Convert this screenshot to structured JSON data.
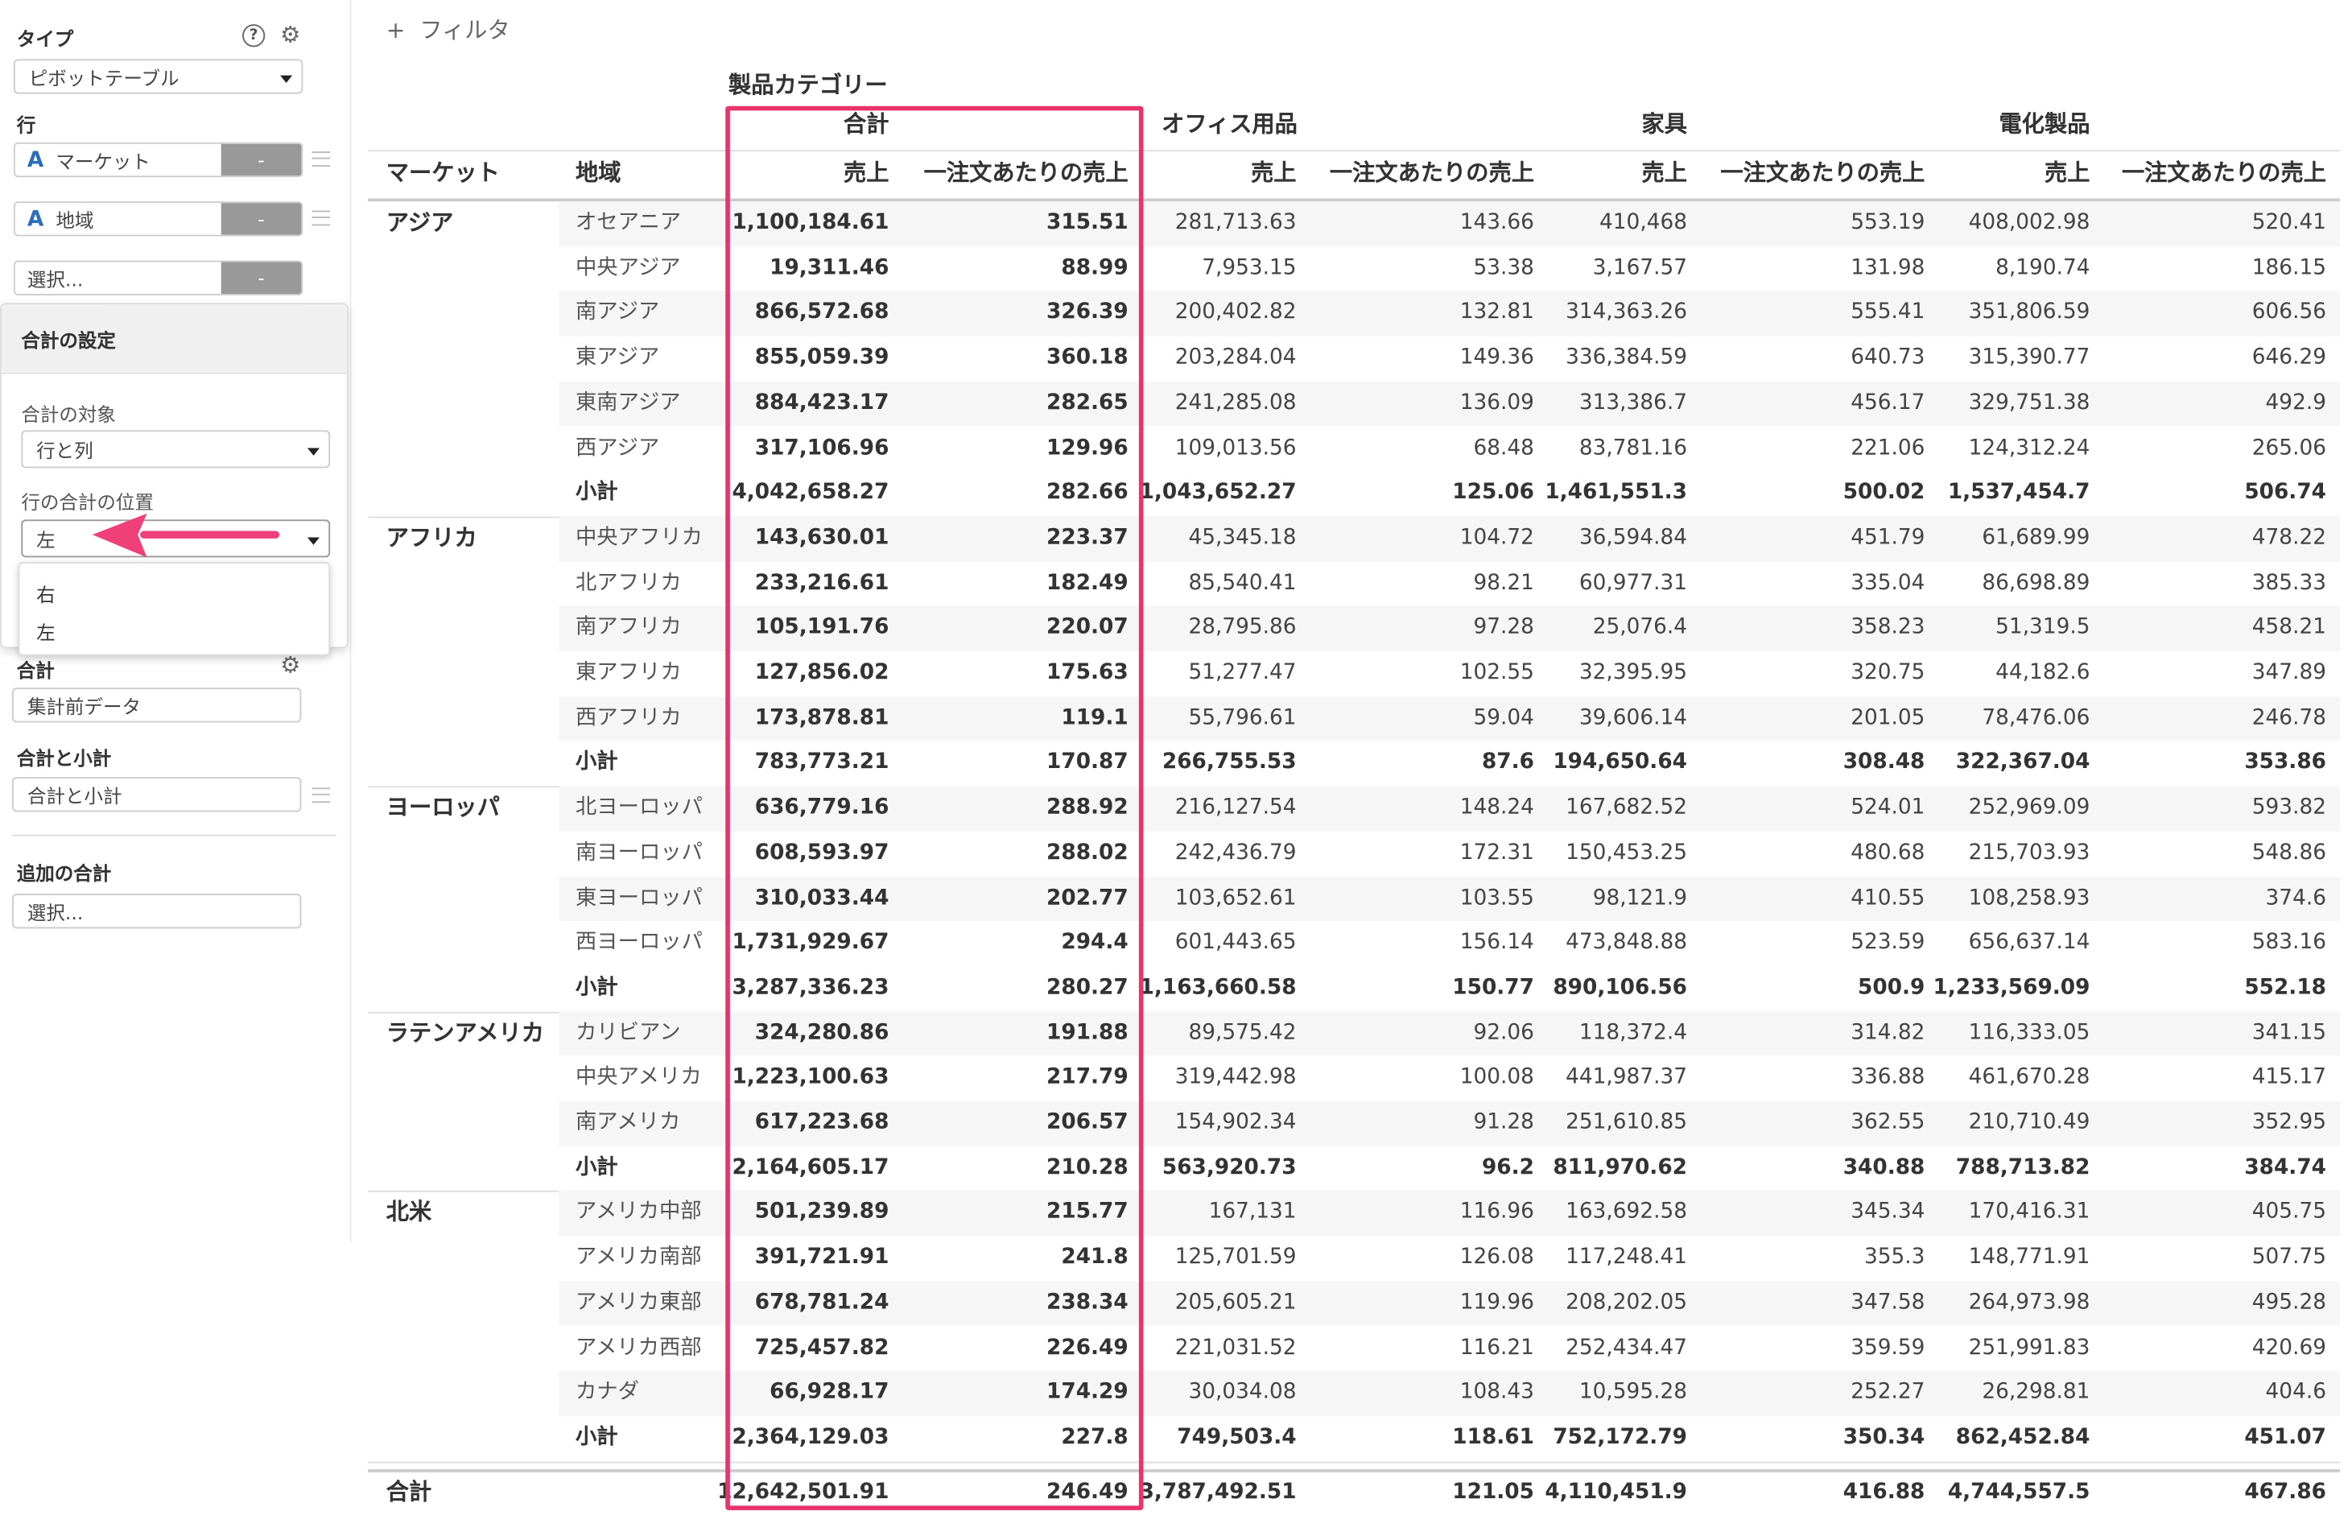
{
  "sidebar": {
    "type_label": "タイプ",
    "type_value": "ピボットテーブル",
    "rows_label": "行",
    "row_fields": [
      "マーケット",
      "地域"
    ],
    "field_type_glyph": "A",
    "remove_label": "-",
    "select_placeholder": "選択...",
    "totals_label": "合計",
    "totals_value": "集計前データ",
    "total_subtotal_label": "合計と小計",
    "total_subtotal_value": "合計と小計",
    "additional_total_label": "追加の合計",
    "additional_total_value": "選択..."
  },
  "popup": {
    "title": "合計の設定",
    "target_label": "合計の対象",
    "target_value": "行と列",
    "position_label": "行の合計の位置",
    "position_value": "左",
    "options": [
      "右",
      "左"
    ],
    "arrow_color": "#f0407a"
  },
  "filter": {
    "icon": "+",
    "label": "フィルタ"
  },
  "table": {
    "column_group_label": "製品カテゴリー",
    "groups": [
      "合計",
      "オフィス用品",
      "家具",
      "電化製品"
    ],
    "row_headers": [
      "マーケット",
      "地域"
    ],
    "measures": [
      "売上",
      "一注文あたりの売上"
    ],
    "highlight_color": "#e8336d",
    "markets": [
      {
        "name": "アジア",
        "rows": [
          {
            "region": "オセアニア",
            "v": [
              "1,100,184.61",
              "315.51",
              "281,713.63",
              "143.66",
              "410,468",
              "553.19",
              "408,002.98",
              "520.41"
            ]
          },
          {
            "region": "中央アジア",
            "v": [
              "19,311.46",
              "88.99",
              "7,953.15",
              "53.38",
              "3,167.57",
              "131.98",
              "8,190.74",
              "186.15"
            ]
          },
          {
            "region": "南アジア",
            "v": [
              "866,572.68",
              "326.39",
              "200,402.82",
              "132.81",
              "314,363.26",
              "555.41",
              "351,806.59",
              "606.56"
            ]
          },
          {
            "region": "東アジア",
            "v": [
              "855,059.39",
              "360.18",
              "203,284.04",
              "149.36",
              "336,384.59",
              "640.73",
              "315,390.77",
              "646.29"
            ]
          },
          {
            "region": "東南アジア",
            "v": [
              "884,423.17",
              "282.65",
              "241,285.08",
              "136.09",
              "313,386.7",
              "456.17",
              "329,751.38",
              "492.9"
            ]
          },
          {
            "region": "西アジア",
            "v": [
              "317,106.96",
              "129.96",
              "109,013.56",
              "68.48",
              "83,781.16",
              "221.06",
              "124,312.24",
              "265.06"
            ]
          },
          {
            "region": "小計",
            "subtotal": true,
            "v": [
              "4,042,658.27",
              "282.66",
              "1,043,652.27",
              "125.06",
              "1,461,551.3",
              "500.02",
              "1,537,454.7",
              "506.74"
            ]
          }
        ]
      },
      {
        "name": "アフリカ",
        "rows": [
          {
            "region": "中央アフリカ",
            "v": [
              "143,630.01",
              "223.37",
              "45,345.18",
              "104.72",
              "36,594.84",
              "451.79",
              "61,689.99",
              "478.22"
            ]
          },
          {
            "region": "北アフリカ",
            "v": [
              "233,216.61",
              "182.49",
              "85,540.41",
              "98.21",
              "60,977.31",
              "335.04",
              "86,698.89",
              "385.33"
            ]
          },
          {
            "region": "南アフリカ",
            "v": [
              "105,191.76",
              "220.07",
              "28,795.86",
              "97.28",
              "25,076.4",
              "358.23",
              "51,319.5",
              "458.21"
            ]
          },
          {
            "region": "東アフリカ",
            "v": [
              "127,856.02",
              "175.63",
              "51,277.47",
              "102.55",
              "32,395.95",
              "320.75",
              "44,182.6",
              "347.89"
            ]
          },
          {
            "region": "西アフリカ",
            "v": [
              "173,878.81",
              "119.1",
              "55,796.61",
              "59.04",
              "39,606.14",
              "201.05",
              "78,476.06",
              "246.78"
            ]
          },
          {
            "region": "小計",
            "subtotal": true,
            "v": [
              "783,773.21",
              "170.87",
              "266,755.53",
              "87.6",
              "194,650.64",
              "308.48",
              "322,367.04",
              "353.86"
            ]
          }
        ]
      },
      {
        "name": "ヨーロッパ",
        "rows": [
          {
            "region": "北ヨーロッパ",
            "v": [
              "636,779.16",
              "288.92",
              "216,127.54",
              "148.24",
              "167,682.52",
              "524.01",
              "252,969.09",
              "593.82"
            ]
          },
          {
            "region": "南ヨーロッパ",
            "v": [
              "608,593.97",
              "288.02",
              "242,436.79",
              "172.31",
              "150,453.25",
              "480.68",
              "215,703.93",
              "548.86"
            ]
          },
          {
            "region": "東ヨーロッパ",
            "v": [
              "310,033.44",
              "202.77",
              "103,652.61",
              "103.55",
              "98,121.9",
              "410.55",
              "108,258.93",
              "374.6"
            ]
          },
          {
            "region": "西ヨーロッパ",
            "v": [
              "1,731,929.67",
              "294.4",
              "601,443.65",
              "156.14",
              "473,848.88",
              "523.59",
              "656,637.14",
              "583.16"
            ]
          },
          {
            "region": "小計",
            "subtotal": true,
            "v": [
              "3,287,336.23",
              "280.27",
              "1,163,660.58",
              "150.77",
              "890,106.56",
              "500.9",
              "1,233,569.09",
              "552.18"
            ]
          }
        ]
      },
      {
        "name": "ラテンアメリカ",
        "rows": [
          {
            "region": "カリビアン",
            "v": [
              "324,280.86",
              "191.88",
              "89,575.42",
              "92.06",
              "118,372.4",
              "314.82",
              "116,333.05",
              "341.15"
            ]
          },
          {
            "region": "中央アメリカ",
            "v": [
              "1,223,100.63",
              "217.79",
              "319,442.98",
              "100.08",
              "441,987.37",
              "336.88",
              "461,670.28",
              "415.17"
            ]
          },
          {
            "region": "南アメリカ",
            "v": [
              "617,223.68",
              "206.57",
              "154,902.34",
              "91.28",
              "251,610.85",
              "362.55",
              "210,710.49",
              "352.95"
            ]
          },
          {
            "region": "小計",
            "subtotal": true,
            "v": [
              "2,164,605.17",
              "210.28",
              "563,920.73",
              "96.2",
              "811,970.62",
              "340.88",
              "788,713.82",
              "384.74"
            ]
          }
        ]
      },
      {
        "name": "北米",
        "rows": [
          {
            "region": "アメリカ中部",
            "v": [
              "501,239.89",
              "215.77",
              "167,131",
              "116.96",
              "163,692.58",
              "345.34",
              "170,416.31",
              "405.75"
            ]
          },
          {
            "region": "アメリカ南部",
            "v": [
              "391,721.91",
              "241.8",
              "125,701.59",
              "126.08",
              "117,248.41",
              "355.3",
              "148,771.91",
              "507.75"
            ]
          },
          {
            "region": "アメリカ東部",
            "v": [
              "678,781.24",
              "238.34",
              "205,605.21",
              "119.96",
              "208,202.05",
              "347.58",
              "264,973.98",
              "495.28"
            ]
          },
          {
            "region": "アメリカ西部",
            "v": [
              "725,457.82",
              "226.49",
              "221,031.52",
              "116.21",
              "252,434.47",
              "359.59",
              "251,991.83",
              "420.69"
            ]
          },
          {
            "region": "カナダ",
            "v": [
              "66,928.17",
              "174.29",
              "30,034.08",
              "108.43",
              "10,595.28",
              "252.27",
              "26,298.81",
              "404.6"
            ]
          },
          {
            "region": "小計",
            "subtotal": true,
            "v": [
              "2,364,129.03",
              "227.8",
              "749,503.4",
              "118.61",
              "752,172.79",
              "350.34",
              "862,452.84",
              "451.07"
            ]
          }
        ]
      }
    ],
    "grand_total": {
      "label": "合計",
      "v": [
        "12,642,501.91",
        "246.49",
        "3,787,492.51",
        "121.05",
        "4,110,451.9",
        "416.88",
        "4,744,557.5",
        "467.86"
      ]
    }
  }
}
